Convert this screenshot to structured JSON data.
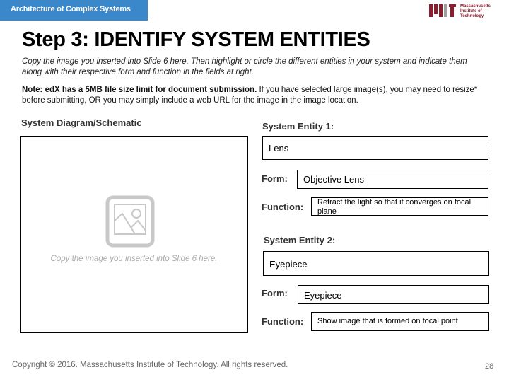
{
  "header": {
    "course_title": "Architecture of Complex Systems",
    "logo_text_lines": [
      "Massachusetts",
      "Institute of",
      "Technology"
    ]
  },
  "slide": {
    "title": "Step 3: IDENTIFY SYSTEM ENTITIES",
    "intro": "Copy the image you inserted into Slide 6 here. Then highlight or circle the different entities in your system and indicate them along with their respective form and function in the fields at right.",
    "note_bold": "Note: edX has a 5MB file size limit for document submission.",
    "note_rest_1": " If you have selected large image(s), you may need to ",
    "note_link": "resize",
    "note_rest_2": "* before submitting, OR you may simply include a web URL for the image in the image location."
  },
  "diagram": {
    "label": "System Diagram/Schematic",
    "placeholder_icon": "image-placeholder-icon",
    "placeholder_text": "Copy the image you inserted into Slide 6 here."
  },
  "entities": [
    {
      "label": "System Entity 1:",
      "name": "Lens",
      "form_label": "Form:",
      "form": "Objective Lens",
      "function_label": "Function:",
      "function": "Refract the light so that it converges on focal plane"
    },
    {
      "label": "System Entity 2:",
      "name": "Eyepiece",
      "form_label": "Form:",
      "form": "Eyepiece",
      "function_label": "Function:",
      "function": "Show image that is formed on focal point"
    }
  ],
  "footer": {
    "copyright": "Copyright © 2016. Massachusetts Institute of Technology. All rights reserved.",
    "page_number": "28"
  },
  "colors": {
    "header_bar": "#3a87c9",
    "mit_red": "#8a1d2e",
    "mit_gray": "#a0a0a0"
  }
}
